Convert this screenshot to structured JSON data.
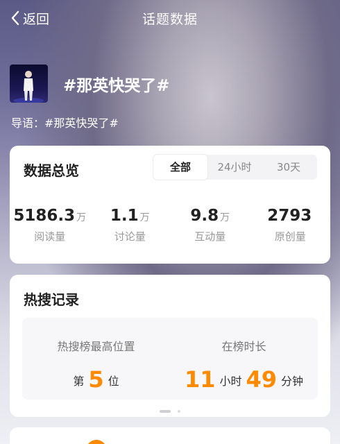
{
  "nav": {
    "back_label": "返回",
    "title": "话题数据"
  },
  "topic": {
    "title": "#那英快哭了#",
    "lead": "导语：#那英快哭了#"
  },
  "overview": {
    "title": "数据总览",
    "tabs": [
      {
        "label": "全部",
        "active": true
      },
      {
        "label": "24小时",
        "active": false
      },
      {
        "label": "30天",
        "active": false
      }
    ],
    "stats": [
      {
        "value": "5186.3",
        "unit": "万",
        "label": "阅读量"
      },
      {
        "value": "1.1",
        "unit": "万",
        "label": "讨论量"
      },
      {
        "value": "9.8",
        "unit": "万",
        "label": "互动量"
      },
      {
        "value": "2793",
        "unit": "",
        "label": "原创量"
      }
    ]
  },
  "hot_search": {
    "title": "热搜记录",
    "peak_header": "热搜榜最高位置",
    "peak_prefix": "第",
    "peak_value": "5",
    "peak_suffix": "位",
    "duration_header": "在榜时长",
    "hours": "11",
    "hours_unit": "小时",
    "minutes": "49",
    "minutes_unit": "分钟",
    "page_indicator": {
      "pages": 2,
      "current": 1
    }
  },
  "colors": {
    "accent": "#ff8a00",
    "text": "#222222",
    "muted": "#999999"
  }
}
